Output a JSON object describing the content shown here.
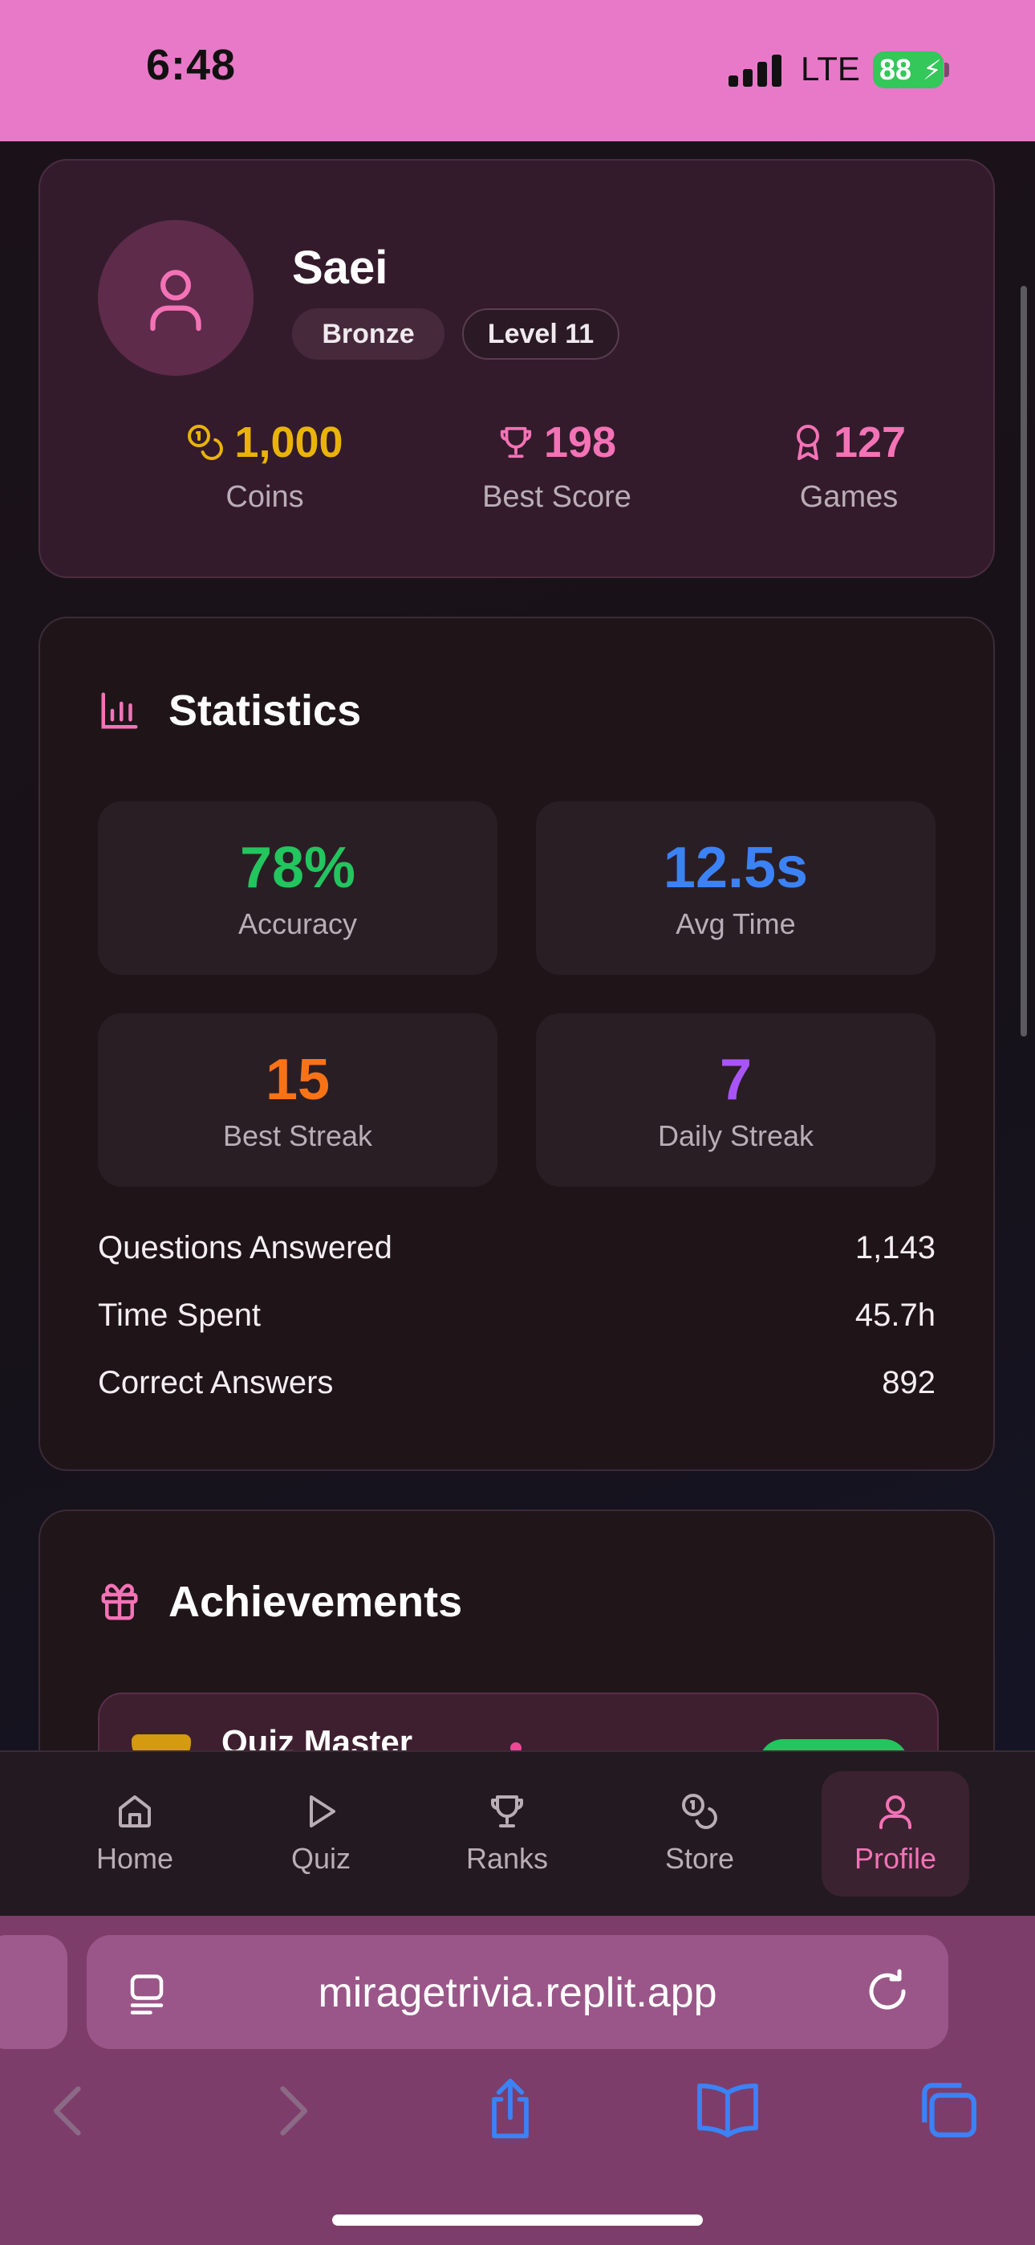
{
  "status_bar": {
    "time": "6:48",
    "network": "LTE",
    "battery": "88"
  },
  "profile": {
    "name": "Saei",
    "tier": "Bronze",
    "level": "Level 11",
    "stats": [
      {
        "value": "1,000",
        "label": "Coins",
        "icon": "coins-icon"
      },
      {
        "value": "198",
        "label": "Best Score",
        "icon": "trophy-icon"
      },
      {
        "value": "127",
        "label": "Games",
        "icon": "award-icon"
      }
    ]
  },
  "statistics": {
    "title": "Statistics",
    "tiles": [
      {
        "value": "78%",
        "label": "Accuracy",
        "color": "#22c55e"
      },
      {
        "value": "12.5s",
        "label": "Avg Time",
        "color": "#3b82f6"
      },
      {
        "value": "15",
        "label": "Best Streak",
        "color": "#f97316"
      },
      {
        "value": "7",
        "label": "Daily Streak",
        "color": "#a855f7"
      }
    ],
    "rows": [
      {
        "label": "Questions Answered",
        "value": "1,143"
      },
      {
        "label": "Time Spent",
        "value": "45.7h"
      },
      {
        "label": "Correct Answers",
        "value": "892"
      }
    ]
  },
  "achievements": {
    "title": "Achievements",
    "items": [
      {
        "name": "Quiz Master"
      }
    ]
  },
  "tabbar": {
    "items": [
      {
        "label": "Home",
        "icon": "home-icon"
      },
      {
        "label": "Quiz",
        "icon": "play-icon"
      },
      {
        "label": "Ranks",
        "icon": "trophy-icon"
      },
      {
        "label": "Store",
        "icon": "coins-icon"
      },
      {
        "label": "Profile",
        "icon": "user-icon",
        "active": true
      }
    ]
  },
  "browser": {
    "url": "miragetrivia.replit.app"
  },
  "colors": {
    "accent": "#f472b6",
    "coins": "#eab308",
    "status_bar": "#e879c8"
  }
}
